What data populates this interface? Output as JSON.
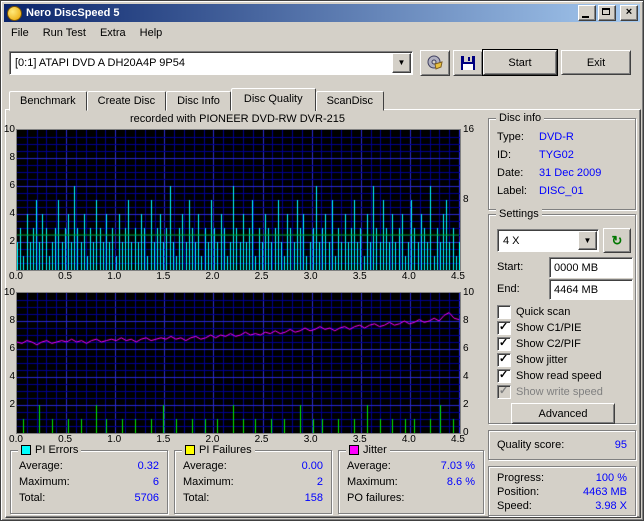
{
  "window": {
    "title": "Nero DiscSpeed 5"
  },
  "menu": {
    "items": [
      "File",
      "Run Test",
      "Extra",
      "Help"
    ]
  },
  "toolbar": {
    "drive_selector": "[0:1]  ATAPI DVD A  DH20A4P 9P54",
    "start_label": "Start",
    "exit_label": "Exit"
  },
  "icons": {
    "dropdown": "▼",
    "refresh": "↻",
    "check": "✓",
    "close": "×"
  },
  "tabs": [
    {
      "label": "Benchmark"
    },
    {
      "label": "Create Disc"
    },
    {
      "label": "Disc Info"
    },
    {
      "label": "Disc Quality"
    },
    {
      "label": "ScanDisc"
    }
  ],
  "recorded_with": "recorded with PIONEER  DVD-RW  DVR-215",
  "disc_info": {
    "title": "Disc info",
    "rows": [
      {
        "label": "Type:",
        "value": "DVD-R"
      },
      {
        "label": "ID:",
        "value": "TYG02"
      },
      {
        "label": "Date:",
        "value": "31 Dec 2009"
      },
      {
        "label": "Label:",
        "value": "DISC_01"
      }
    ]
  },
  "settings": {
    "title": "Settings",
    "speed_value": "4 X",
    "start_label": "Start:",
    "start_value": "0000 MB",
    "end_label": "End:",
    "end_value": "4464 MB",
    "checkboxes": [
      {
        "label": "Quick scan",
        "checked": false,
        "disabled": false
      },
      {
        "label": "Show C1/PIE",
        "checked": true,
        "disabled": false
      },
      {
        "label": "Show C2/PIF",
        "checked": true,
        "disabled": false
      },
      {
        "label": "Show jitter",
        "checked": true,
        "disabled": false
      },
      {
        "label": "Show read speed",
        "checked": true,
        "disabled": false
      },
      {
        "label": "Show write speed",
        "checked": true,
        "disabled": true
      }
    ],
    "advanced_label": "Advanced"
  },
  "quality": {
    "label": "Quality score:",
    "value": "95"
  },
  "stats": {
    "pi_errors": {
      "title": "PI Errors",
      "color": "#00ffff",
      "rows": [
        [
          "Average:",
          "0.32"
        ],
        [
          "Maximum:",
          "6"
        ],
        [
          "Total:",
          "5706"
        ]
      ]
    },
    "pi_failures": {
      "title": "PI Failures",
      "color": "#ffff00",
      "rows": [
        [
          "Average:",
          "0.00"
        ],
        [
          "Maximum:",
          "2"
        ],
        [
          "Total:",
          "158"
        ]
      ]
    },
    "jitter": {
      "title": "Jitter",
      "color": "#ff00ff",
      "rows": [
        [
          "Average:",
          "7.03 %"
        ],
        [
          "Maximum:",
          "8.6 %"
        ],
        [
          "PO failures:",
          ""
        ]
      ]
    }
  },
  "progress": {
    "rows": [
      [
        "Progress:",
        "100 %"
      ],
      [
        "Position:",
        "4463 MB"
      ],
      [
        "Speed:",
        "3.98 X"
      ]
    ]
  },
  "chart_data": [
    {
      "type": "line",
      "title": "PI Errors / read speed vs position (GB)",
      "x_range": [
        0,
        4.5
      ],
      "x_ticks": [
        "0.0",
        "0.5",
        "1.0",
        "1.5",
        "2.0",
        "2.5",
        "3.0",
        "3.5",
        "4.0",
        "4.5"
      ],
      "left_axis": {
        "max": 10,
        "ticks": [
          "10",
          "8",
          "6",
          "4",
          "2"
        ]
      },
      "right_axis": {
        "max": 16,
        "ticks": [
          "16",
          "8"
        ]
      },
      "grid": true,
      "series": [
        {
          "name": "PI Errors",
          "color": "#00ffff",
          "style": "spikes",
          "axis": "left",
          "values": [
            2,
            3,
            1,
            4,
            2,
            3,
            5,
            2,
            4,
            3,
            1,
            2,
            3,
            5,
            2,
            3,
            4,
            2,
            6,
            3,
            2,
            4,
            1,
            3,
            2,
            5,
            3,
            2,
            4,
            2,
            3,
            1,
            4,
            2,
            3,
            5,
            2,
            3,
            2,
            4,
            3,
            1,
            5,
            2,
            3,
            4,
            2,
            3,
            6,
            2,
            1,
            3,
            4,
            2,
            5,
            3,
            2,
            4,
            1,
            3,
            2,
            5,
            3,
            2,
            4,
            3,
            1,
            2,
            6,
            3,
            2,
            4,
            2,
            3,
            5,
            1,
            3,
            2,
            4,
            3,
            2,
            3,
            5,
            2,
            1,
            4,
            3,
            2,
            5,
            3,
            4,
            1,
            2,
            3,
            6,
            2,
            3,
            4,
            2,
            5,
            1,
            3,
            2,
            4,
            2,
            3,
            5,
            2,
            3,
            1,
            4,
            2,
            6,
            3,
            2,
            5,
            3,
            2,
            4,
            2,
            3,
            4,
            1,
            2,
            5,
            3,
            2,
            4,
            3,
            2,
            6,
            1,
            3,
            2,
            4,
            5,
            2,
            3,
            1,
            2
          ]
        },
        {
          "name": "Read speed",
          "color": "#00aa00",
          "style": "line",
          "axis": "right",
          "values": [
            4,
            4,
            4,
            4,
            4,
            4,
            4,
            4,
            4,
            4
          ]
        }
      ]
    },
    {
      "type": "line",
      "title": "Jitter / PI Failures vs position (GB)",
      "x_range": [
        0,
        4.5
      ],
      "x_ticks": [
        "0.0",
        "0.5",
        "1.0",
        "1.5",
        "2.0",
        "2.5",
        "3.0",
        "3.5",
        "4.0",
        "4.5"
      ],
      "left_axis": {
        "max": 10,
        "ticks": [
          "10",
          "8",
          "6",
          "4",
          "2"
        ]
      },
      "right_axis": {
        "max": 10,
        "ticks": [
          "10",
          "8",
          "6",
          "4",
          "2",
          "0"
        ]
      },
      "grid": true,
      "series": [
        {
          "name": "PI Failures",
          "color": "#00ee00",
          "style": "spikes",
          "axis": "left",
          "values": [
            0,
            0,
            1,
            0,
            0,
            0,
            0,
            2,
            0,
            0,
            0,
            1,
            0,
            0,
            0,
            0,
            1,
            0,
            0,
            0,
            1,
            0,
            0,
            0,
            0,
            2,
            0,
            0,
            1,
            0,
            0,
            0,
            0,
            1,
            0,
            0,
            0,
            1,
            0,
            0,
            0,
            0,
            1,
            0,
            0,
            0,
            2,
            0,
            0,
            0,
            1,
            0,
            0,
            0,
            0,
            1,
            0,
            0,
            0,
            1,
            0,
            0,
            0,
            1,
            0,
            0,
            0,
            0,
            2,
            0,
            0,
            1,
            0,
            0,
            0,
            1,
            0,
            0,
            0,
            0,
            1,
            0,
            0,
            0,
            1,
            0,
            0,
            0,
            0,
            2,
            0,
            0,
            0,
            1,
            0,
            0,
            1,
            0,
            0,
            0,
            0,
            1,
            0,
            0,
            0,
            0,
            1,
            0,
            0,
            0,
            2,
            0,
            0,
            0,
            1,
            0,
            0,
            0,
            1,
            0,
            0,
            0,
            1,
            0,
            0,
            1,
            0,
            0,
            0,
            0,
            1,
            0,
            0,
            2,
            0,
            0,
            0,
            1,
            0,
            0
          ]
        },
        {
          "name": "Jitter",
          "color": "#ff00ff",
          "style": "line",
          "axis": "left",
          "values": [
            6.5,
            6.4,
            6.6,
            6.5,
            6.3,
            6.5,
            6.6,
            6.4,
            6.5,
            6.6,
            6.5,
            6.7,
            6.5,
            6.6,
            6.4,
            6.6,
            6.7,
            6.5,
            6.6,
            6.7,
            6.6,
            6.8,
            6.6,
            6.7,
            6.5,
            6.7,
            6.8,
            6.6,
            6.7,
            6.8,
            6.7,
            6.9,
            6.7,
            6.8,
            6.6,
            6.8,
            6.9,
            6.7,
            6.8,
            7.0,
            6.8,
            7.0,
            6.9,
            7.1,
            6.9,
            7.0,
            7.2,
            7.0,
            7.1,
            7.0,
            7.2,
            7.1,
            7.3,
            7.1,
            7.2,
            7.4,
            7.2,
            7.3,
            7.5,
            7.3,
            7.4,
            7.6,
            7.4,
            7.5,
            7.3,
            7.5,
            7.6,
            7.4,
            7.6,
            7.7,
            7.5,
            7.7,
            7.8,
            7.6,
            7.7,
            7.9,
            7.7,
            7.8,
            8.0,
            7.8,
            7.9,
            8.1,
            7.9,
            8.0,
            8.2,
            8.0,
            8.4,
            8.6,
            8.2,
            8.1
          ]
        }
      ]
    }
  ]
}
